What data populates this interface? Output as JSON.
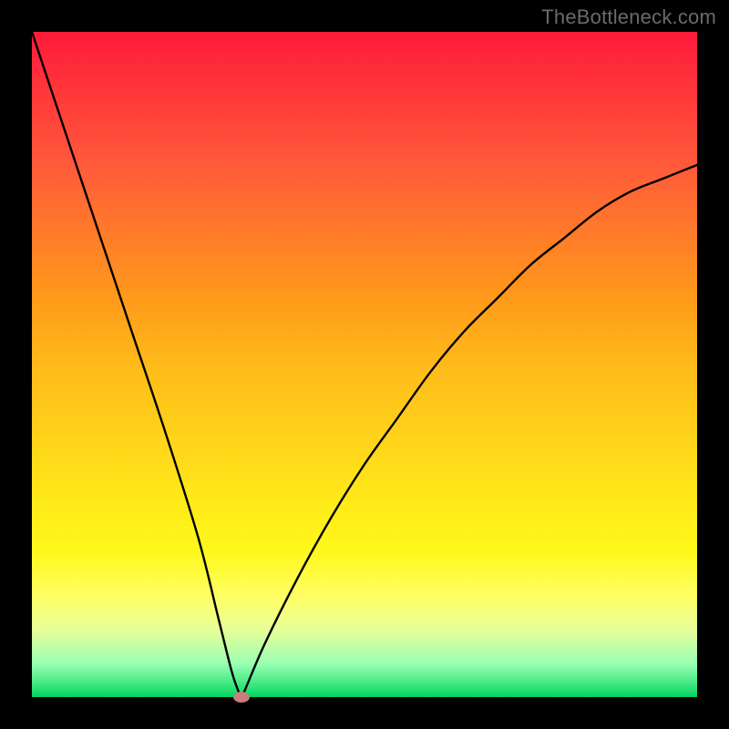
{
  "watermark": "TheBottleneck.com",
  "chart_data": {
    "type": "line",
    "title": "",
    "xlabel": "",
    "ylabel": "",
    "xlim": [
      0,
      100
    ],
    "ylim": [
      0,
      100
    ],
    "grid": false,
    "legend": false,
    "series": [
      {
        "name": "curve",
        "x": [
          0,
          5,
          10,
          15,
          20,
          25,
          28,
          30,
          31,
          31.5,
          32,
          35,
          40,
          45,
          50,
          55,
          60,
          65,
          70,
          75,
          80,
          85,
          90,
          95,
          100
        ],
        "y": [
          100,
          85,
          70,
          55,
          40,
          24,
          12,
          4,
          1,
          0,
          1,
          8,
          18,
          27,
          35,
          42,
          49,
          55,
          60,
          65,
          69,
          73,
          76,
          78,
          80
        ]
      }
    ],
    "marker": {
      "x": 31.5,
      "y": 0,
      "color": "#c97d7d"
    },
    "gradient_stops": [
      {
        "pos": 0,
        "color": "#ff1a3a"
      },
      {
        "pos": 50,
        "color": "#ffd11a"
      },
      {
        "pos": 85,
        "color": "#ffff66"
      },
      {
        "pos": 100,
        "color": "#00d060"
      }
    ]
  }
}
